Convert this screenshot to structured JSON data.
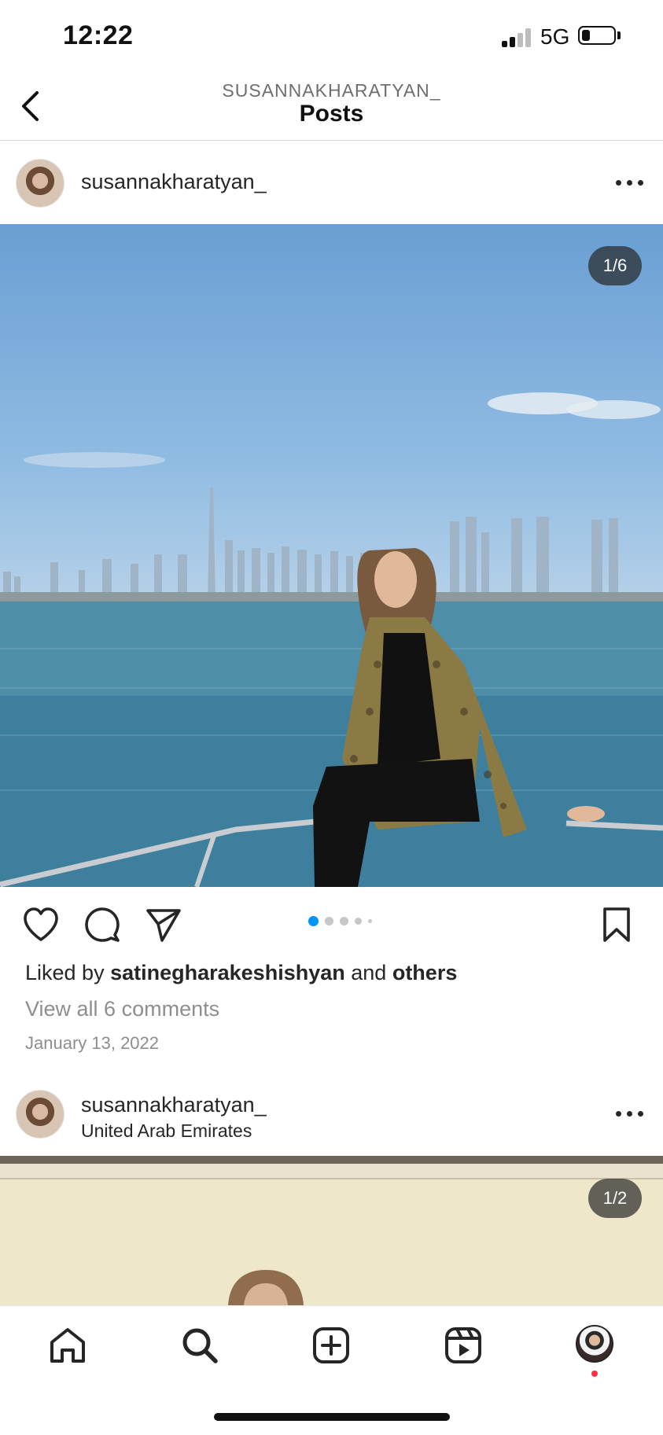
{
  "status_bar": {
    "time": "12:22",
    "network": "5G",
    "battery_level": 0.25
  },
  "header": {
    "username": "SUSANNAKHARATYAN_",
    "title": "Posts"
  },
  "post1": {
    "username": "susannakharatyan_",
    "photo_counter": "1/6",
    "carousel_dot_count": 5,
    "active_dot": 0,
    "liked_by_prefix": "Liked by",
    "liked_by_user": "satinegharakeshishyan",
    "liked_by_and": "and",
    "liked_by_others": "others",
    "view_comments": "View all 6 comments",
    "date": "January 13, 2022"
  },
  "post2": {
    "username": "susannakharatyan_",
    "location": "United Arab Emirates",
    "photo_counter": "1/2"
  },
  "nav": {
    "items": [
      "home-icon",
      "search-icon",
      "new-post-icon",
      "reels-icon",
      "profile-avatar"
    ],
    "notification_dot_color": "#ff3040"
  },
  "colors": {
    "accent": "#0095f6",
    "text": "#262626",
    "muted": "#8e8e8e"
  }
}
